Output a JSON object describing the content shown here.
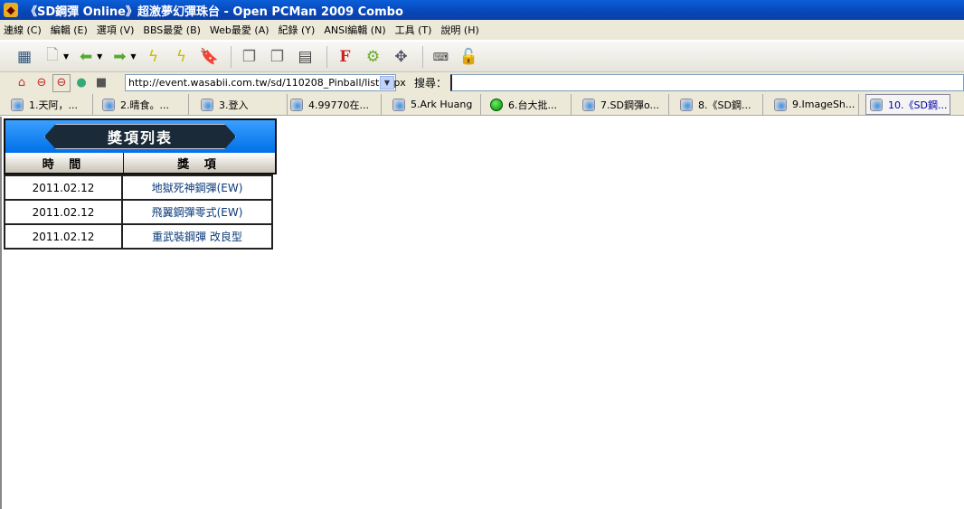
{
  "window": {
    "title": "《SD鋼彈 Online》超激夢幻彈珠台 - Open PCMan 2009 Combo"
  },
  "menu": [
    "連線 (C)",
    "編輯 (E)",
    "選項 (V)",
    "BBS最愛 (B)",
    "Web最愛 (A)",
    "紀錄 (Y)",
    "ANSI編輯 (N)",
    "工具 (T)",
    "說明 (H)"
  ],
  "address": {
    "url": "http://event.wasabii.com.tw/sd/110208_Pinball/list.aspx",
    "search_label": "搜尋："
  },
  "tabs": [
    {
      "label": "1.天阿，...",
      "icon": "page"
    },
    {
      "label": "2.晴食。...",
      "icon": "page"
    },
    {
      "label": "3.登入",
      "icon": "page"
    },
    {
      "label": "4.99770在...",
      "icon": "page"
    },
    {
      "label": "5.Ark Huang",
      "icon": "page"
    },
    {
      "label": "6.台大批...",
      "icon": "green-dot"
    },
    {
      "label": "7.SD鋼彈o...",
      "icon": "page"
    },
    {
      "label": "8.《SD鋼...",
      "icon": "page"
    },
    {
      "label": "9.ImageSh...",
      "icon": "page"
    },
    {
      "label": "10.《SD鋼...",
      "icon": "page",
      "active": true
    }
  ],
  "award": {
    "title": "獎項列表",
    "col_time": "時 間",
    "col_prize": "獎 項",
    "rows": [
      {
        "date": "2011.02.12",
        "prize": "地獄死神鋼彈(EW)"
      },
      {
        "date": "2011.02.12",
        "prize": "飛翼鋼彈零式(EW)"
      },
      {
        "date": "2011.02.12",
        "prize": "重武裝鋼彈 改良型"
      }
    ]
  }
}
